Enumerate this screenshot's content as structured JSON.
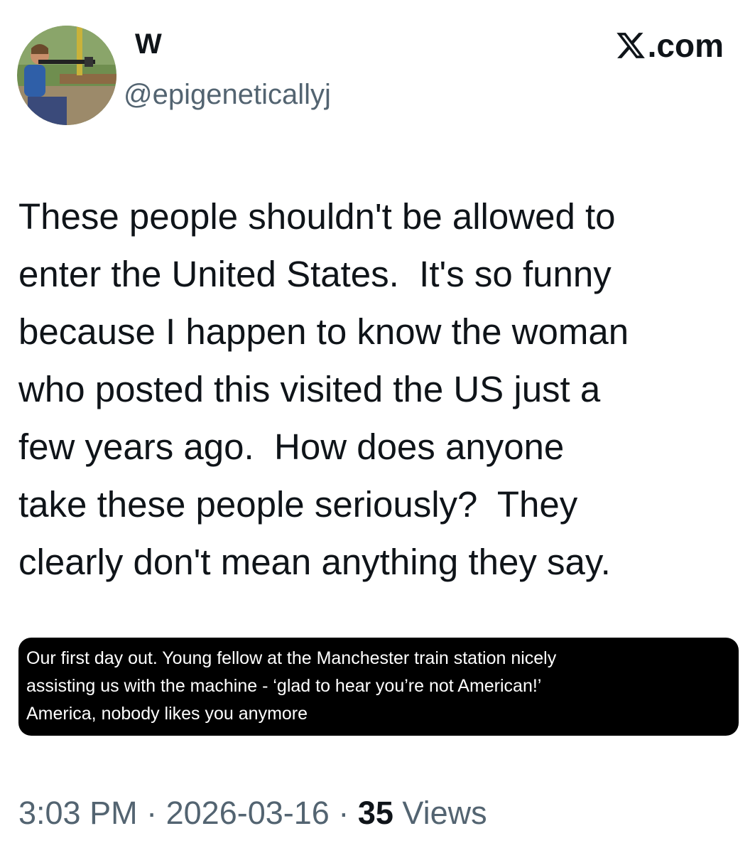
{
  "author": {
    "display_name": "W",
    "handle": "@epigeneticallyj",
    "avatar_icon": "avatar-photo"
  },
  "brand": {
    "text": ".com",
    "logo_icon": "x-logo-icon"
  },
  "tweet": {
    "text": "These people shouldn't be allowed to\nenter the United States.  It's so funny\nbecause I happen to know the woman\nwho posted this visited the US just a\nfew years ago.  How does anyone\ntake these people seriously?  They\nclearly don't mean anything they say."
  },
  "quoted": {
    "text": "Our first day out. Young fellow at the Manchester train station nicely\nassisting us with the machine - ‘glad to hear you’re not American!’\nAmerica, nobody likes you anymore"
  },
  "meta": {
    "time": "3:03 PM",
    "separator": "·",
    "date": "2026-03-16",
    "views_count": "35",
    "views_label": "Views"
  },
  "colors": {
    "text_primary": "#0f1419",
    "text_secondary": "#536471",
    "quote_background": "#000000"
  }
}
